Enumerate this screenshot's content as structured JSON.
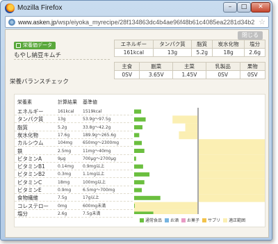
{
  "window": {
    "title": "Mozilla Firefox",
    "url_host": "www.asken.jp",
    "url_path": "/wsp/eiyoka_myrecipe/28f134863dc4b4ae96f48b61c4085ea2281d34b2",
    "minimize_label": "–",
    "maximize_label": "□",
    "close_label": "✕"
  },
  "page": {
    "close_button": "閉じる",
    "badge": "栄養価データ",
    "food_name": "もやし納豆キムチ",
    "balance_title": "栄養バランスチェック"
  },
  "summary1": {
    "headers": [
      "エネルギー",
      "タンパク質",
      "脂質",
      "炭水化物",
      "塩分"
    ],
    "values": [
      "161kcal",
      "13g",
      "5.2g",
      "18g",
      "2.6g"
    ]
  },
  "summary2": {
    "headers": [
      "主食",
      "副菜",
      "主菜",
      "乳製品",
      "果物"
    ],
    "values": [
      "0SV",
      "3.65V",
      "1.45V",
      "0SV",
      "0SV"
    ]
  },
  "balance": {
    "headers": [
      "栄養素",
      "計算結果",
      "基準値"
    ],
    "legend": [
      "通常食品",
      "お酒",
      "お菓子",
      "サプリ",
      "適正範囲"
    ]
  },
  "chart_data": {
    "type": "bar",
    "categories": [
      "エネルギー",
      "タンパク質",
      "脂質",
      "炭水化物",
      "カルシウム",
      "鉄",
      "ビタミンA",
      "ビタミンB1",
      "ビタミンB2",
      "ビタミンC",
      "ビタミンE",
      "食物繊維",
      "コレステロー",
      "塩分"
    ],
    "results": [
      "161kcal",
      "13g",
      "5.2g",
      "17.6g",
      "104mg",
      "2.5mg",
      "9μg",
      "0.14mg",
      "0.3mg",
      "18mg",
      "0.9mg",
      "7.5g",
      "0mg",
      "2.6g"
    ],
    "standards": [
      "1519kcal",
      "53.9g〜97.5g",
      "33.8g〜42.2g",
      "189.9g〜265.6g",
      "650mg〜2300mg",
      "11mg〜40mg",
      "700μg〜2700μg",
      "0.9mg以上",
      "1.1mg以上",
      "100mg以上",
      "6.5mg〜700mg",
      "17g以上",
      "600mg未満",
      "7.5g未満"
    ],
    "values": [
      11,
      18,
      13,
      8,
      12,
      16,
      3,
      14,
      24,
      16,
      12,
      41,
      1,
      30
    ],
    "range_low": [
      0,
      60,
      80,
      70,
      0,
      0,
      0,
      0,
      0,
      0,
      0,
      0,
      0,
      0
    ],
    "range_high": [
      0,
      100,
      100,
      100,
      0,
      0,
      0,
      0,
      0,
      0,
      0,
      0,
      0,
      0
    ],
    "open_range": [
      false,
      false,
      false,
      false,
      true,
      true,
      true,
      true,
      true,
      true,
      true,
      true,
      false,
      false
    ],
    "under_range": [
      false,
      false,
      false,
      false,
      false,
      false,
      false,
      false,
      false,
      false,
      false,
      false,
      true,
      true
    ],
    "colors": {
      "normal": "#6bbf3f",
      "range": "#fbefb3",
      "alcohol": "#76b4e0",
      "sweets": "#e89bc4",
      "supplement": "#f2c24a"
    }
  }
}
